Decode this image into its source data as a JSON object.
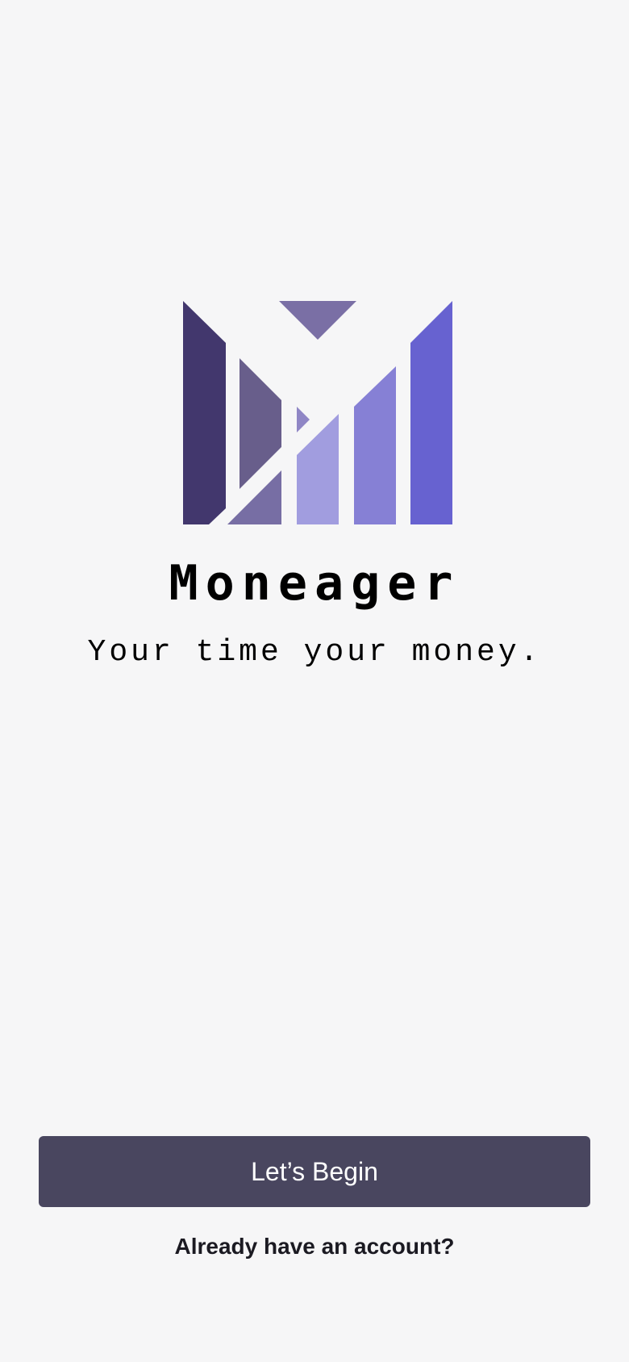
{
  "app": {
    "name": "Moneager",
    "tagline": "Your time your money."
  },
  "logo": {
    "icon": "moneager-m-logo",
    "colors": {
      "left_bar": "#42376d",
      "top_triangle": "#7a6fa5",
      "left_inner": "#685e8b",
      "left_lower": "#776ea4",
      "small_triangle": "#8f86c5",
      "middle_bar": "#a19ddf",
      "right_inner": "#8680d5",
      "right_bar": "#6762d0"
    }
  },
  "actions": {
    "begin_label": "Let’s Begin",
    "account_label": "Already have an account?"
  },
  "colors": {
    "background": "#f6f6f7",
    "button": "#49465f",
    "button_text": "#ffffff",
    "text": "#000000"
  }
}
